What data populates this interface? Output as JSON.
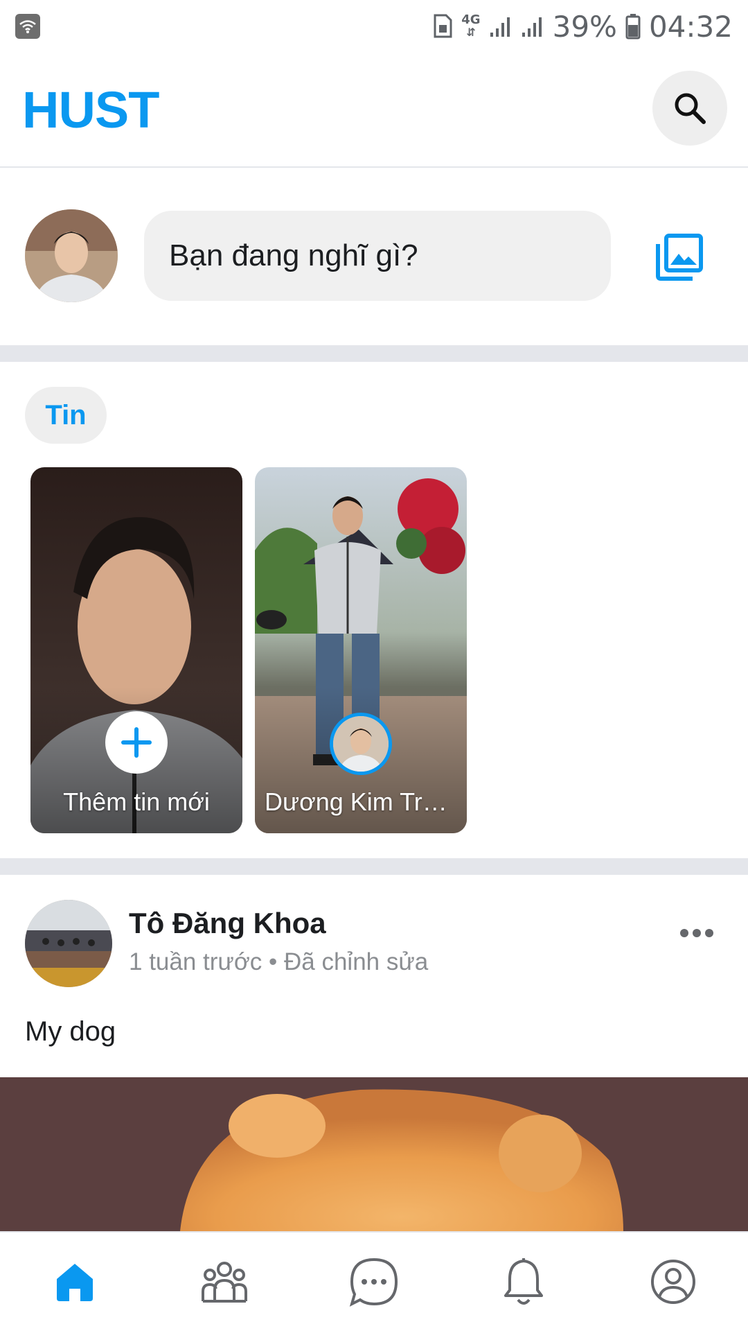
{
  "status_bar": {
    "network": "4G",
    "battery_percent": "39%",
    "time": "04:32"
  },
  "header": {
    "brand": "HUST"
  },
  "composer": {
    "placeholder": "Bạn đang nghĩ gì?"
  },
  "stories": {
    "section_label": "Tin",
    "items": [
      {
        "label": "Thêm tin mới"
      },
      {
        "label": "Dương Kim Trư..."
      }
    ]
  },
  "post": {
    "author": "Tô Đăng Khoa",
    "meta": "1 tuần trước • Đã chỉnh sửa",
    "text": "My dog"
  },
  "bottom_nav": {
    "items": [
      {
        "icon": "home-icon",
        "active": true
      },
      {
        "icon": "friends-icon",
        "active": false
      },
      {
        "icon": "chat-icon",
        "active": false
      },
      {
        "icon": "bell-icon",
        "active": false
      },
      {
        "icon": "profile-icon",
        "active": false
      }
    ]
  },
  "colors": {
    "accent": "#0a98f0",
    "muted_icon": "#65676b",
    "divider": "#e4e6eb"
  }
}
